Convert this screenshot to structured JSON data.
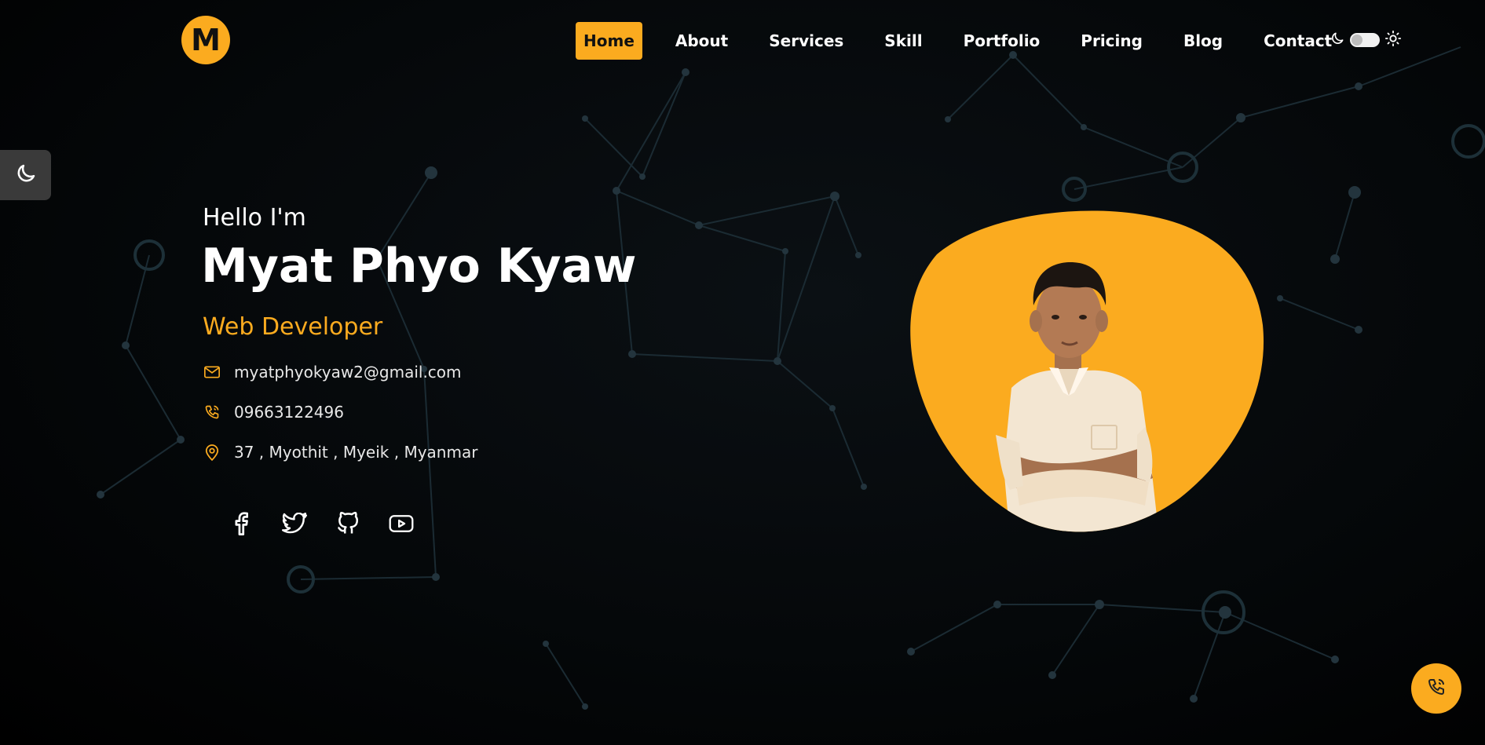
{
  "header": {
    "logo_letter": "M",
    "nav": [
      "Home",
      "About",
      "Services",
      "Skill",
      "Portfolio",
      "Pricing",
      "Blog",
      "Contact"
    ],
    "active_nav": "Home",
    "theme_toggle_icons": [
      "moon-icon",
      "sun-icon"
    ]
  },
  "hero": {
    "greeting": "Hello I'm",
    "name": "Myat Phyo Kyaw",
    "role": "Web Developer",
    "email": "myatphyokyaw2@gmail.com",
    "phone": "09663122496",
    "address": "37 , Myothit , Myeik , Myanmar",
    "social_icons": [
      "facebook-icon",
      "twitter-icon",
      "github-icon",
      "youtube-icon"
    ]
  },
  "colors": {
    "accent": "#fbab1f",
    "background": "#000000",
    "text": "#ffffff"
  }
}
